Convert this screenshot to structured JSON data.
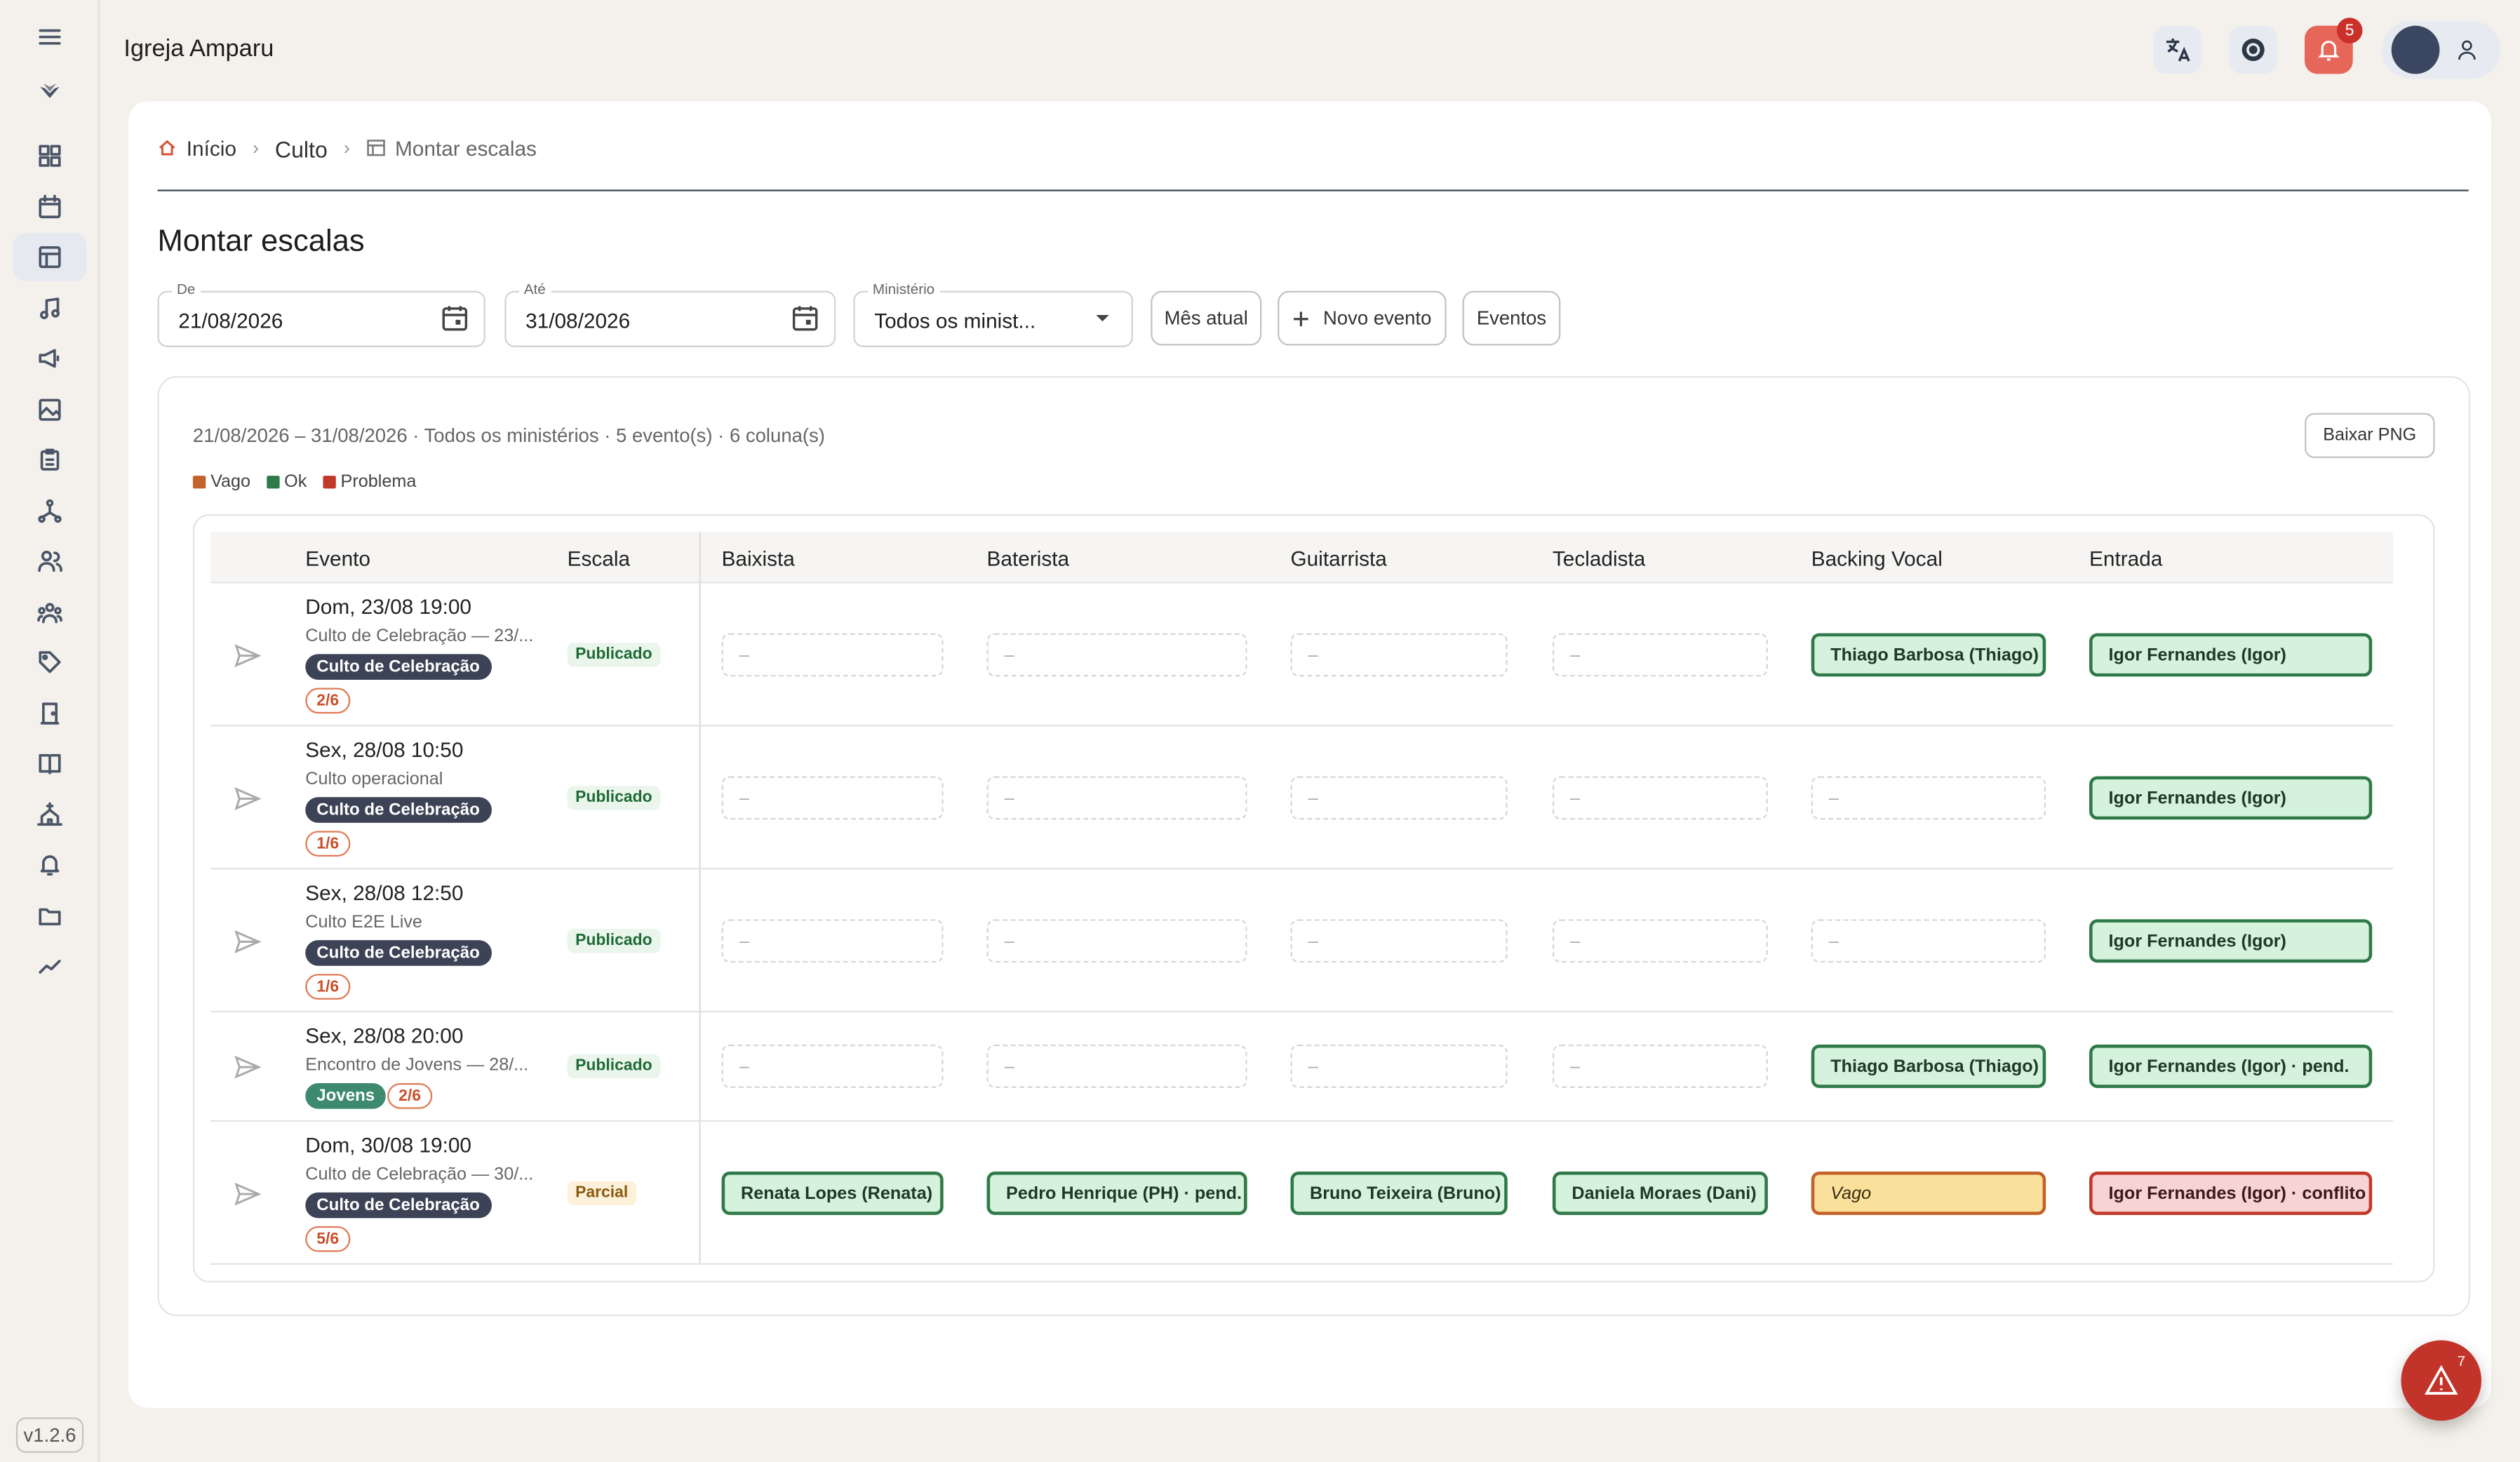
{
  "app": {
    "title": "Igreja Amparu",
    "version": "v1.2.6",
    "notifications": "5",
    "alerts": "7"
  },
  "breadcrumb": {
    "home": "Início",
    "section": "Culto",
    "current": "Montar escalas"
  },
  "page": {
    "title": "Montar escalas"
  },
  "filters": {
    "from_label": "De",
    "from_value": "21/08/2026",
    "to_label": "Até",
    "to_value": "31/08/2026",
    "ministry_label": "Ministério",
    "ministry_value": "Todos os minist...",
    "current_month": "Mês atual",
    "new_event": "Novo evento",
    "events": "Eventos"
  },
  "summary": "21/08/2026 – 31/08/2026 · Todos os ministérios · 5 evento(s) · 6 coluna(s)",
  "download": "Baixar PNG",
  "legend": [
    {
      "label": "Vago",
      "color": "#c2632b"
    },
    {
      "label": "Ok",
      "color": "#2f7a48"
    },
    {
      "label": "Problema",
      "color": "#c0392b"
    }
  ],
  "table": {
    "headers": {
      "event": "Evento",
      "scale": "Escala",
      "cols": [
        "Baixista",
        "Baterista",
        "Guitarrista",
        "Tecladista",
        "Backing Vocal",
        "Entrada"
      ]
    },
    "rows": [
      {
        "date": "Dom, 23/08 19:00",
        "desc": "Culto de Celebração — 23/...",
        "tag": "Culto de Celebração",
        "count": "2/6",
        "status": "Publicado",
        "cells": [
          "–",
          "–",
          "–",
          "–",
          "Thiago Barbosa (Thiago)",
          "Igor Fernandes (Igor)"
        ]
      },
      {
        "date": "Sex, 28/08 10:50",
        "desc": "Culto operacional",
        "tag": "Culto de Celebração",
        "count": "1/6",
        "status": "Publicado",
        "cells": [
          "–",
          "–",
          "–",
          "–",
          "–",
          "Igor Fernandes (Igor)"
        ]
      },
      {
        "date": "Sex, 28/08 12:50",
        "desc": "Culto E2E Live",
        "tag": "Culto de Celebração",
        "count": "1/6",
        "status": "Publicado",
        "cells": [
          "–",
          "–",
          "–",
          "–",
          "–",
          "Igor Fernandes (Igor)"
        ]
      },
      {
        "date": "Sex, 28/08 20:00",
        "desc": "Encontro de Jovens — 28/...",
        "tag": "Jovens",
        "count": "2/6",
        "status": "Publicado",
        "cells": [
          "–",
          "–",
          "–",
          "–",
          "Thiago Barbosa (Thiago)",
          "Igor Fernandes (Igor) · pend."
        ]
      },
      {
        "date": "Dom, 30/08 19:00",
        "desc": "Culto de Celebração — 30/...",
        "tag": "Culto de Celebração",
        "count": "5/6",
        "status": "Parcial",
        "cells": [
          "Renata Lopes (Renata)",
          "Pedro Henrique (PH) · pend.",
          "Bruno Teixeira (Bruno)",
          "Daniela Moraes (Dani)",
          "Vago",
          "Igor Fernandes (Igor) · conflito"
        ]
      }
    ]
  }
}
